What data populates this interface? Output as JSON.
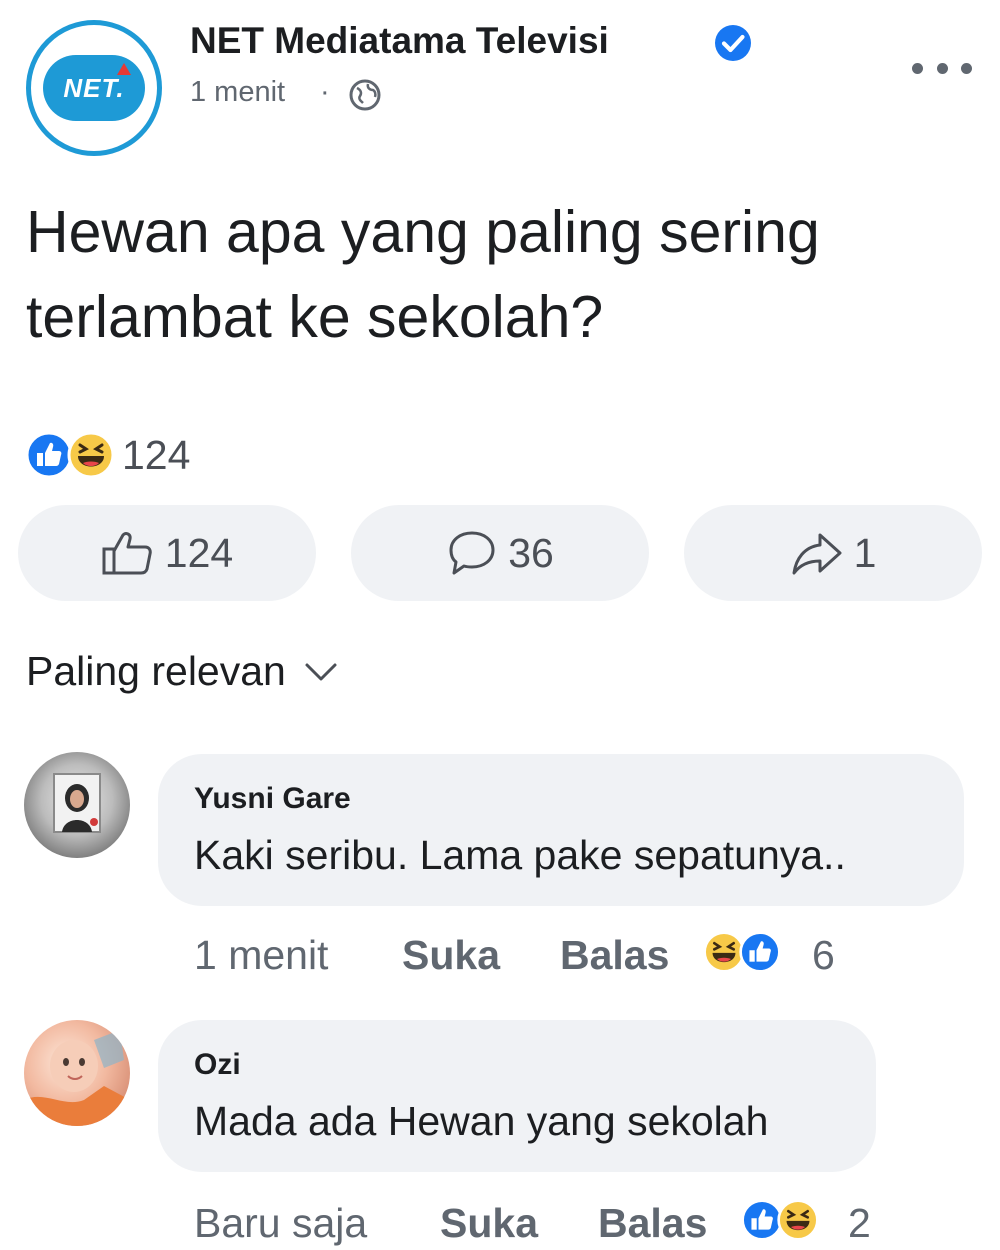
{
  "post": {
    "page_name": "NET Mediatama Televisi",
    "page_logo_text": "NET.",
    "time": "1 menit",
    "separator": "·",
    "text": "Hewan apa yang paling sering terlambat ke sekolah?",
    "reaction_count": "124",
    "actions": {
      "like_count": "124",
      "comment_count": "36",
      "share_count": "1"
    }
  },
  "sort": {
    "label": "Paling relevan"
  },
  "comments": [
    {
      "author": "Yusni Gare",
      "text": "Kaki seribu. Lama pake sepatunya..",
      "time": "1 menit",
      "like_label": "Suka",
      "reply_label": "Balas",
      "reaction_count": "6"
    },
    {
      "author": "Ozi",
      "text": "Mada ada Hewan yang sekolah",
      "time": "Baru saja",
      "like_label": "Suka",
      "reply_label": "Balas",
      "reaction_count": "2"
    }
  ],
  "colors": {
    "brand_blue": "#1e9ad6",
    "like_blue": "#1877f2",
    "haha_yellow": "#f7c948",
    "bubble_bg": "#f0f2f5",
    "meta_gray": "#606770"
  },
  "icons": [
    "net-logo-icon",
    "verified-badge-icon",
    "globe-icon",
    "more-options-icon",
    "like-reaction-icon",
    "haha-reaction-icon",
    "thumbs-up-icon",
    "comment-icon",
    "share-icon",
    "chevron-down-icon"
  ]
}
